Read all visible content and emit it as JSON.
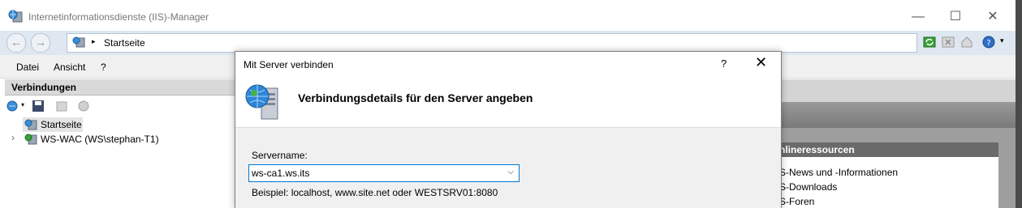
{
  "window": {
    "title": "Internetinformationsdienste (IIS)-Manager",
    "minimize": "—",
    "maximize": "☐",
    "close": "✕"
  },
  "address": {
    "back": "←",
    "forward": "→",
    "separator": "▸",
    "path": "Startseite"
  },
  "menu": [
    "Datei",
    "Ansicht",
    "?"
  ],
  "connections": {
    "header": "Verbindungen",
    "tree": [
      {
        "label": "Startseite",
        "selected": true
      },
      {
        "label": "WS-WAC (WS\\stephan-T1)",
        "expander": "›"
      }
    ]
  },
  "dialog": {
    "title": "Mit Server verbinden",
    "help": "?",
    "close": "✕",
    "heading": "Verbindungsdetails für den Server angeben",
    "server_label": "Servername:",
    "server_value": "ws-ca1.ws.its",
    "dropdown_arrow": "⌵",
    "hint": "Beispiel: localhost, www.site.net oder WESTSRV01:8080"
  },
  "online": {
    "header": "nlineressourcen",
    "links": [
      "S-News und -Informationen",
      "S-Downloads",
      "S-Foren"
    ]
  },
  "colors": {
    "accent": "#0078d7",
    "addrbar": "#dfe7f1"
  }
}
